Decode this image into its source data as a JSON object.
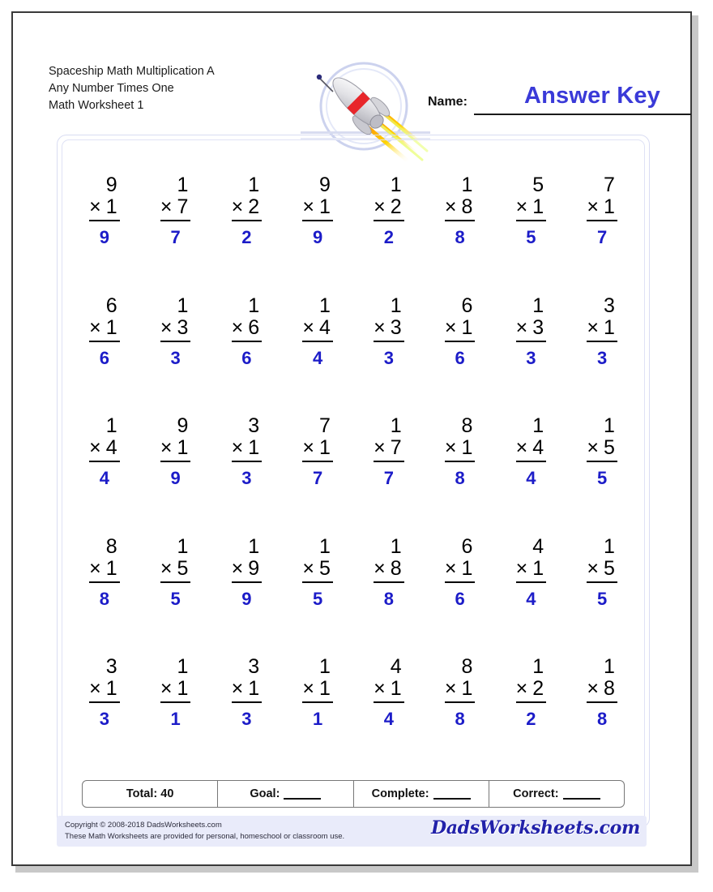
{
  "header": {
    "title_lines": [
      "Spaceship Math Multiplication A",
      "Any Number Times One",
      "Math Worksheet 1"
    ],
    "name_label": "Name:",
    "answer_key_text": "Answer Key",
    "rocket_icon": "rocket-icon"
  },
  "colors": {
    "answer_blue": "#1c1cc8",
    "answer_key_blue": "#3a3ad8",
    "frame_lavender": "#d9dcf2",
    "footer_bg": "#e9ebfa",
    "rocket_stripe_red": "#e8262b"
  },
  "worksheet": {
    "operator": "×",
    "rows": [
      [
        {
          "top": "9",
          "bottom": "1",
          "answer": "9"
        },
        {
          "top": "1",
          "bottom": "7",
          "answer": "7"
        },
        {
          "top": "1",
          "bottom": "2",
          "answer": "2"
        },
        {
          "top": "9",
          "bottom": "1",
          "answer": "9"
        },
        {
          "top": "1",
          "bottom": "2",
          "answer": "2"
        },
        {
          "top": "1",
          "bottom": "8",
          "answer": "8"
        },
        {
          "top": "5",
          "bottom": "1",
          "answer": "5"
        },
        {
          "top": "7",
          "bottom": "1",
          "answer": "7"
        }
      ],
      [
        {
          "top": "6",
          "bottom": "1",
          "answer": "6"
        },
        {
          "top": "1",
          "bottom": "3",
          "answer": "3"
        },
        {
          "top": "1",
          "bottom": "6",
          "answer": "6"
        },
        {
          "top": "1",
          "bottom": "4",
          "answer": "4"
        },
        {
          "top": "1",
          "bottom": "3",
          "answer": "3"
        },
        {
          "top": "6",
          "bottom": "1",
          "answer": "6"
        },
        {
          "top": "1",
          "bottom": "3",
          "answer": "3"
        },
        {
          "top": "3",
          "bottom": "1",
          "answer": "3"
        }
      ],
      [
        {
          "top": "1",
          "bottom": "4",
          "answer": "4"
        },
        {
          "top": "9",
          "bottom": "1",
          "answer": "9"
        },
        {
          "top": "3",
          "bottom": "1",
          "answer": "3"
        },
        {
          "top": "7",
          "bottom": "1",
          "answer": "7"
        },
        {
          "top": "1",
          "bottom": "7",
          "answer": "7"
        },
        {
          "top": "8",
          "bottom": "1",
          "answer": "8"
        },
        {
          "top": "1",
          "bottom": "4",
          "answer": "4"
        },
        {
          "top": "1",
          "bottom": "5",
          "answer": "5"
        }
      ],
      [
        {
          "top": "8",
          "bottom": "1",
          "answer": "8"
        },
        {
          "top": "1",
          "bottom": "5",
          "answer": "5"
        },
        {
          "top": "1",
          "bottom": "9",
          "answer": "9"
        },
        {
          "top": "1",
          "bottom": "5",
          "answer": "5"
        },
        {
          "top": "1",
          "bottom": "8",
          "answer": "8"
        },
        {
          "top": "6",
          "bottom": "1",
          "answer": "6"
        },
        {
          "top": "4",
          "bottom": "1",
          "answer": "4"
        },
        {
          "top": "1",
          "bottom": "5",
          "answer": "5"
        }
      ],
      [
        {
          "top": "3",
          "bottom": "1",
          "answer": "3"
        },
        {
          "top": "1",
          "bottom": "1",
          "answer": "1"
        },
        {
          "top": "3",
          "bottom": "1",
          "answer": "3"
        },
        {
          "top": "1",
          "bottom": "1",
          "answer": "1"
        },
        {
          "top": "4",
          "bottom": "1",
          "answer": "4"
        },
        {
          "top": "8",
          "bottom": "1",
          "answer": "8"
        },
        {
          "top": "1",
          "bottom": "2",
          "answer": "2"
        },
        {
          "top": "1",
          "bottom": "8",
          "answer": "8"
        }
      ]
    ]
  },
  "score_bar": {
    "total_label": "Total: 40",
    "goal_label": "Goal:",
    "complete_label": "Complete:",
    "correct_label": "Correct:"
  },
  "footer": {
    "copyright": "Copyright © 2008-2018 DadsWorksheets.com",
    "usage_note": "These Math Worksheets are provided for personal, homeschool or classroom use.",
    "brand": "DadsWorksheets.com"
  }
}
